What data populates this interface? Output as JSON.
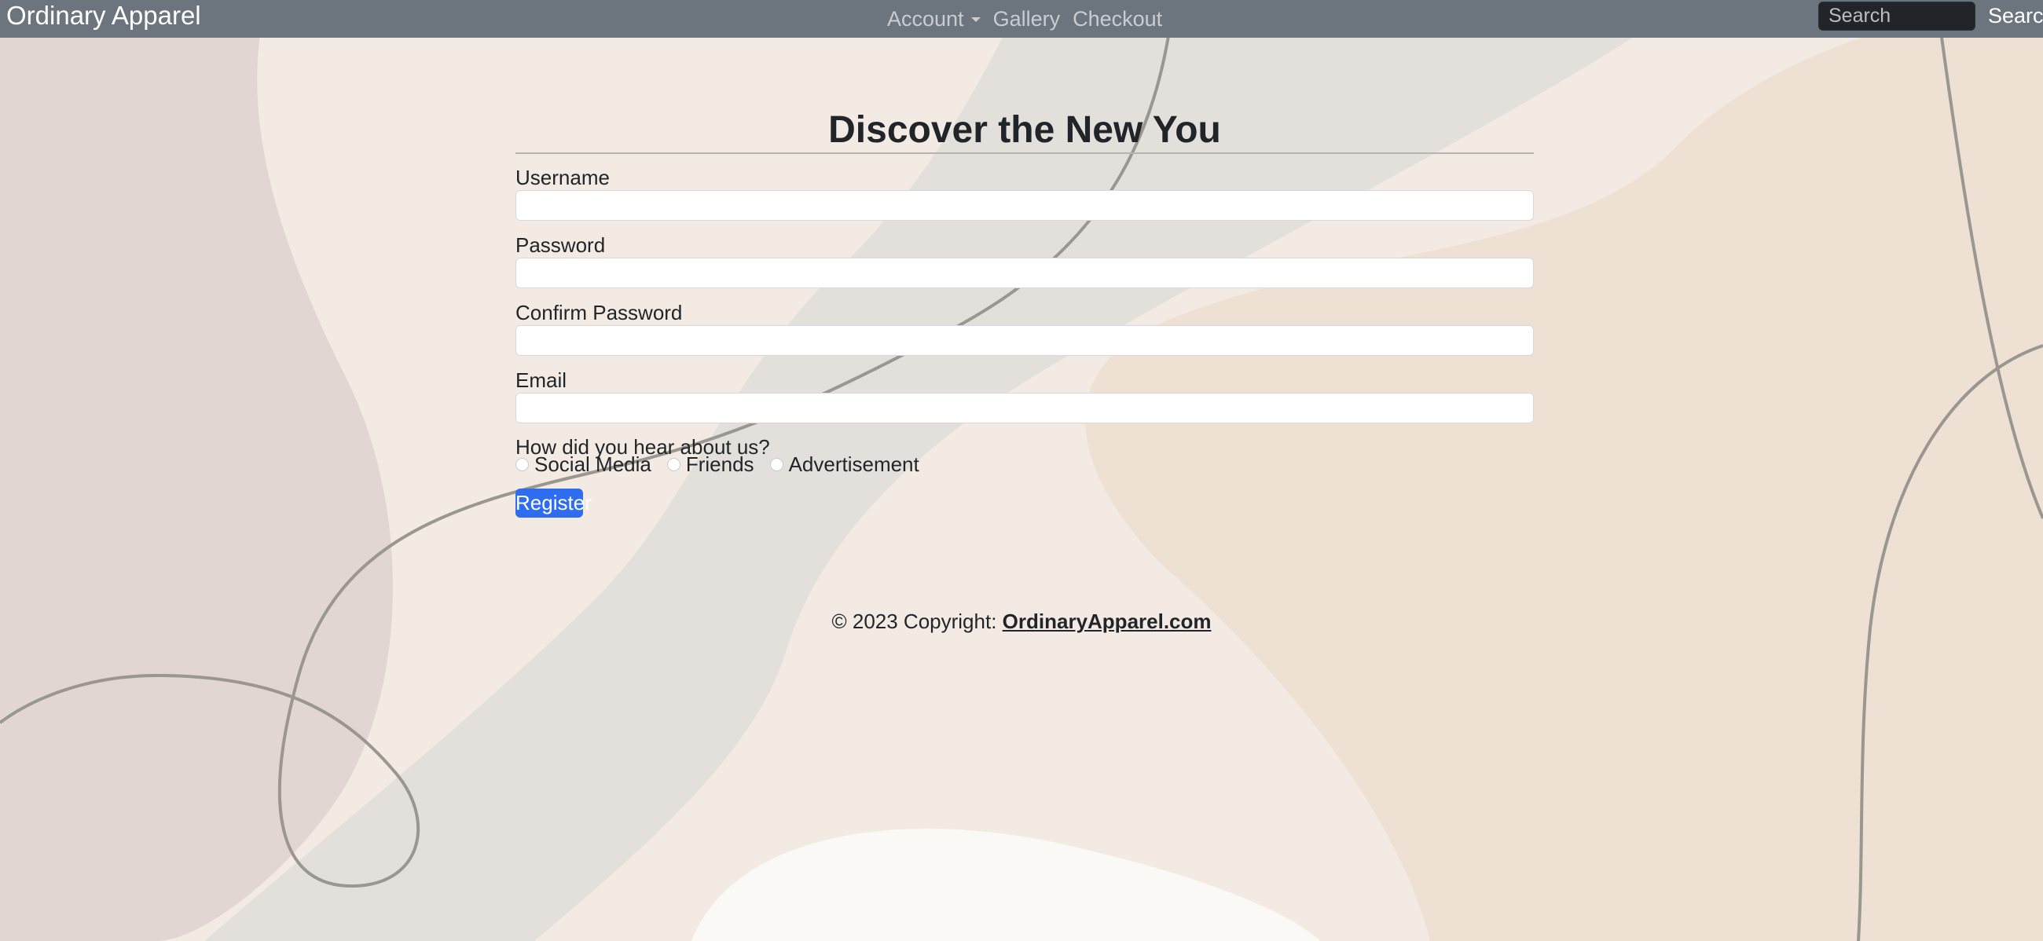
{
  "navbar": {
    "brand": "Ordinary Apparel",
    "links": [
      "Account",
      "Gallery",
      "Checkout"
    ],
    "search_placeholder": "Search",
    "search_button": "Search"
  },
  "form": {
    "title": "Discover the New You",
    "username_label": "Username",
    "password_label": "Password",
    "confirm_password_label": "Confirm Password",
    "email_label": "Email",
    "referral_question": "How did you hear about us?",
    "referral_options": [
      "Social Media",
      "Friends",
      "Advertisement"
    ],
    "register_button": "Register"
  },
  "footer": {
    "copyright": "© 2023 Copyright: ",
    "link_text": "OrdinaryApparel.com"
  },
  "colors": {
    "navbar_bg": "#6c757d",
    "primary": "#2f6df0",
    "background": "#efe7df"
  }
}
